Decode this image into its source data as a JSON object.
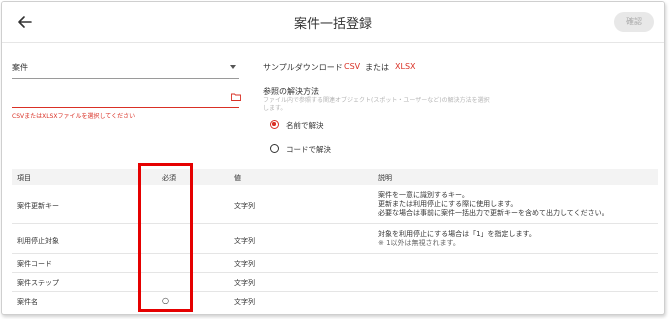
{
  "header": {
    "title": "案件一括登録",
    "confirm_label": "確認"
  },
  "form": {
    "select_value": "案件",
    "file_error": "CSVまたはXLSXファイルを選択してください",
    "sample_label": "サンプルダウンロード",
    "sample_csv": "CSV",
    "sample_or": "または",
    "sample_xlsx": "XLSX",
    "resolve_title": "参照の解決方法",
    "resolve_desc": "ファイル内で参照する関連オブジェクト(スポット・ユーザーなど)の解決方法を選択します。",
    "radio_name": "名前で解決",
    "radio_code": "コードで解決"
  },
  "table": {
    "headers": [
      "項目",
      "必須",
      "値",
      "説明"
    ],
    "rows": [
      {
        "item": "案件更新キー",
        "required": "",
        "value": "文字列",
        "desc": [
          "案件を一意に識別するキー。",
          "更新または利用停止にする際に使用します。",
          "必要な場合は事前に案件一括出力で更新キーを含めて出力してください。"
        ]
      },
      {
        "item": "利用停止対象",
        "required": "",
        "value": "文字列",
        "desc": [
          "対象を利用停止にする場合は「1」を指定します。",
          "※ 1以外は無視されます。"
        ]
      },
      {
        "item": "案件コード",
        "required": "",
        "value": "文字列",
        "desc": []
      },
      {
        "item": "案件ステップ",
        "required": "",
        "value": "文字列",
        "desc": []
      },
      {
        "item": "案件名",
        "required": "○",
        "value": "文字列",
        "desc": []
      }
    ]
  },
  "colors": {
    "accent": "#d93025",
    "highlight": "#e50000"
  }
}
